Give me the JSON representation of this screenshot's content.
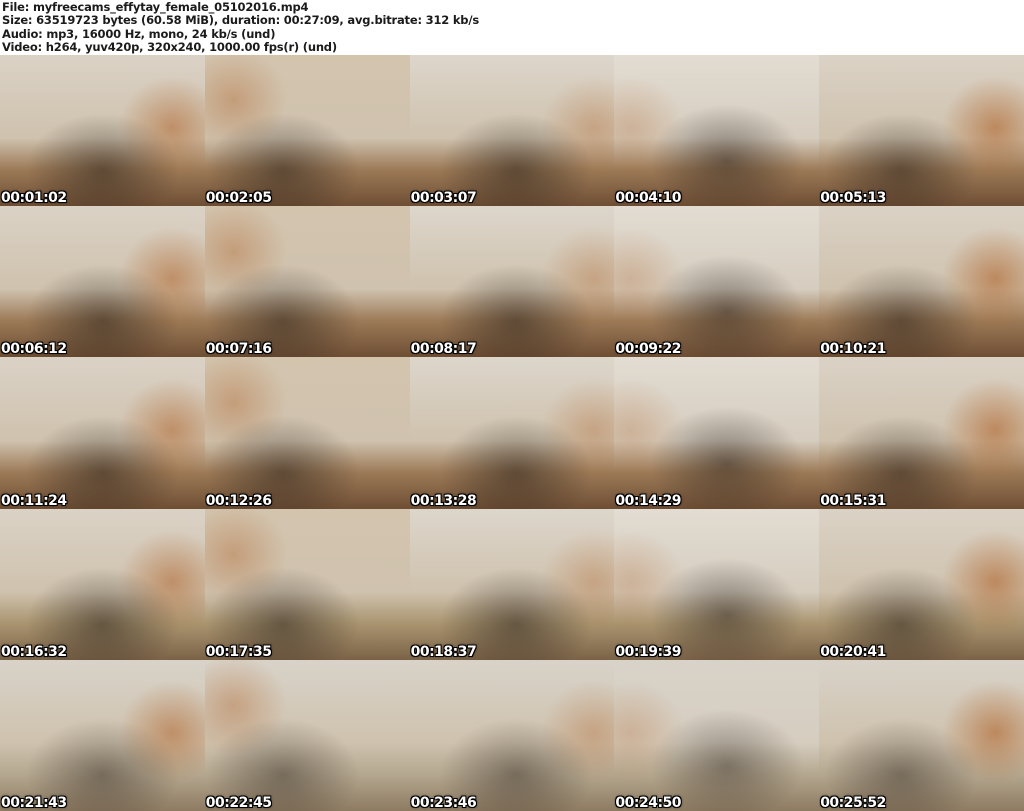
{
  "file_info": {
    "file_line": "File: myfreecams_effytay_female_05102016.mp4",
    "size_line": "Size: 63519723 bytes (60.58 MiB), duration: 00:27:09, avg.bitrate: 312 kb/s",
    "audio_line": "Audio: mp3, 16000 Hz, mono, 24 kb/s (und)",
    "video_line": "Video: h264, yuv420p, 320x240, 1000.00 fps(r) (und)"
  },
  "thumbnails": [
    {
      "timestamp": "00:01:02"
    },
    {
      "timestamp": "00:02:05"
    },
    {
      "timestamp": "00:03:07"
    },
    {
      "timestamp": "00:04:10"
    },
    {
      "timestamp": "00:05:13"
    },
    {
      "timestamp": "00:06:12"
    },
    {
      "timestamp": "00:07:16"
    },
    {
      "timestamp": "00:08:17"
    },
    {
      "timestamp": "00:09:22"
    },
    {
      "timestamp": "00:10:21"
    },
    {
      "timestamp": "00:11:24"
    },
    {
      "timestamp": "00:12:26"
    },
    {
      "timestamp": "00:13:28"
    },
    {
      "timestamp": "00:14:29"
    },
    {
      "timestamp": "00:15:31"
    },
    {
      "timestamp": "00:16:32"
    },
    {
      "timestamp": "00:17:35"
    },
    {
      "timestamp": "00:18:37"
    },
    {
      "timestamp": "00:19:39"
    },
    {
      "timestamp": "00:20:41"
    },
    {
      "timestamp": "00:21:43"
    },
    {
      "timestamp": "00:22:45"
    },
    {
      "timestamp": "00:23:46"
    },
    {
      "timestamp": "00:24:50"
    },
    {
      "timestamp": "00:25:52"
    }
  ],
  "colors": {
    "header_text": "#1b1b1b",
    "page_background": "#ffffff",
    "timestamp_text": "#ffffff",
    "timestamp_outline": "#000000"
  }
}
